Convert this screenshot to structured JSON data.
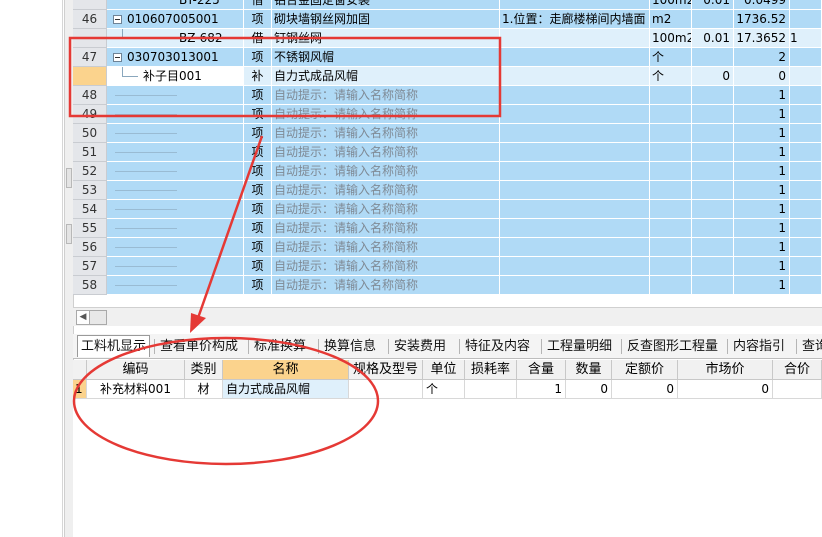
{
  "grid": {
    "top_partial": {
      "code": "BY-225",
      "type": "借",
      "name": "铝合金固定窗安装",
      "unit": "100m2",
      "qty": "0.01",
      "price": "0.0499"
    },
    "rows": [
      {
        "num": "46",
        "code": "010607005001",
        "type": "项",
        "name": "砌块墙钢丝网加固",
        "feature": "1.位置：走廊楼梯间内墙面",
        "unit": "m2",
        "qty": "",
        "price": "1736.52",
        "style": "blue",
        "tree": "minus"
      },
      {
        "num": "",
        "code": "BZ-682",
        "type": "借",
        "name": "钉钢丝网",
        "feature": "",
        "unit": "100m2",
        "qty": "0.01",
        "price": "17.3652",
        "extra": "1",
        "style": "pale",
        "tree": "child"
      },
      {
        "num": "47",
        "code": "030703013001",
        "type": "项",
        "name": "不锈钢风帽",
        "feature": "",
        "unit": "个",
        "qty": "",
        "price": "2",
        "style": "blue",
        "tree": "minus"
      },
      {
        "num": "",
        "code": "补子目001",
        "type": "补",
        "name": "自力式成品风帽",
        "feature": "",
        "unit": "个",
        "qty": "0",
        "price": "0",
        "style": "pale",
        "tree": "child",
        "selected": true
      },
      {
        "num": "48",
        "code": "",
        "type": "项",
        "name": "自动提示：请输入名称简称",
        "unit": "",
        "qty": "",
        "price": "1",
        "style": "blue",
        "hint": true
      },
      {
        "num": "49",
        "code": "",
        "type": "项",
        "name": "自动提示：请输入名称简称",
        "unit": "",
        "qty": "",
        "price": "1",
        "style": "blue",
        "hint": true
      },
      {
        "num": "50",
        "code": "",
        "type": "项",
        "name": "自动提示：请输入名称简称",
        "unit": "",
        "qty": "",
        "price": "1",
        "style": "blue",
        "hint": true
      },
      {
        "num": "51",
        "code": "",
        "type": "项",
        "name": "自动提示：请输入名称简称",
        "unit": "",
        "qty": "",
        "price": "1",
        "style": "blue",
        "hint": true
      },
      {
        "num": "52",
        "code": "",
        "type": "项",
        "name": "自动提示：请输入名称简称",
        "unit": "",
        "qty": "",
        "price": "1",
        "style": "blue",
        "hint": true
      },
      {
        "num": "53",
        "code": "",
        "type": "项",
        "name": "自动提示：请输入名称简称",
        "unit": "",
        "qty": "",
        "price": "1",
        "style": "blue",
        "hint": true
      },
      {
        "num": "54",
        "code": "",
        "type": "项",
        "name": "自动提示：请输入名称简称",
        "unit": "",
        "qty": "",
        "price": "1",
        "style": "blue",
        "hint": true
      },
      {
        "num": "55",
        "code": "",
        "type": "项",
        "name": "自动提示：请输入名称简称",
        "unit": "",
        "qty": "",
        "price": "1",
        "style": "blue",
        "hint": true
      },
      {
        "num": "56",
        "code": "",
        "type": "项",
        "name": "自动提示：请输入名称简称",
        "unit": "",
        "qty": "",
        "price": "1",
        "style": "blue",
        "hint": true
      },
      {
        "num": "57",
        "code": "",
        "type": "项",
        "name": "自动提示：请输入名称简称",
        "unit": "",
        "qty": "",
        "price": "1",
        "style": "blue",
        "hint": true
      },
      {
        "num": "58",
        "code": "",
        "type": "项",
        "name": "自动提示：请输入名称简称",
        "unit": "",
        "qty": "",
        "price": "1",
        "style": "blue",
        "hint": true
      }
    ]
  },
  "tabs": [
    "工料机显示",
    "查看单价构成",
    "标准换算",
    "换算信息",
    "安装费用",
    "特征及内容",
    "工程量明细",
    "反查图形工程量",
    "内容指引",
    "查询"
  ],
  "subgrid": {
    "headers": [
      "编码",
      "类别",
      "名称",
      "规格及型号",
      "单位",
      "损耗率",
      "含量",
      "数量",
      "定额价",
      "市场价",
      "合价"
    ],
    "row": {
      "num": "1",
      "code": "补充材料001",
      "category": "材",
      "name": "自力式成品风帽",
      "spec": "",
      "unit": "个",
      "loss": "",
      "content": "1",
      "quantity": "0",
      "quota_price": "0",
      "market_price": "0",
      "total": ""
    }
  },
  "colors": {
    "row_blue": "#b0daf6",
    "row_pale": "#dff0fb",
    "selection": "#fbd38d",
    "annotation": "#e53935"
  }
}
